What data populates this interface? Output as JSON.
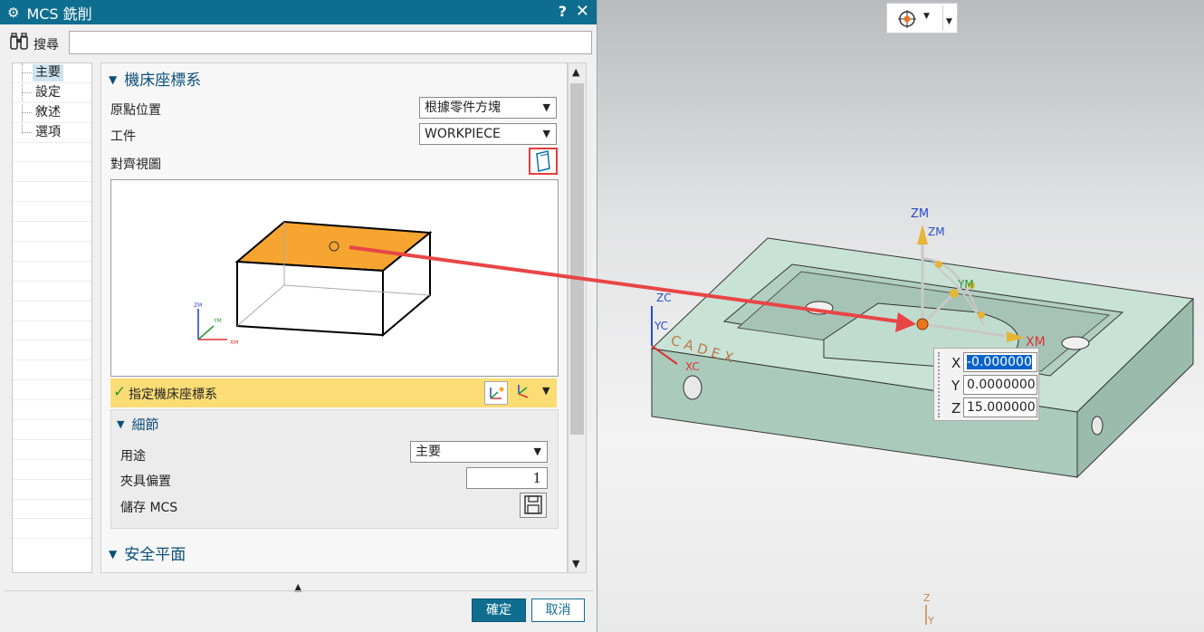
{
  "dialog": {
    "title": "MCS 銑削",
    "help": "?",
    "close": "✕",
    "search_label": "搜尋",
    "search_value": "",
    "nav": [
      "主要",
      "設定",
      "敘述",
      "選項"
    ],
    "section_main": "機床座標系",
    "origin_label": "原點位置",
    "origin_value": "根據零件方塊",
    "workpiece_label": "工件",
    "workpiece_value": "WORKPIECE",
    "align_view_label": "對齊視圖",
    "specify_mcs": "指定機床座標系",
    "details_title": "細節",
    "purpose_label": "用途",
    "purpose_value": "主要",
    "fixture_label": "夾具偏置",
    "fixture_value": "1",
    "save_mcs_label": "儲存 MCS",
    "safe_plane": "安全平面",
    "ok": "確定",
    "cancel": "取消",
    "preview_axes": {
      "zm": "ZM",
      "ym": "YM",
      "xm": "XM"
    }
  },
  "viewport": {
    "axes": {
      "zm": "ZM",
      "ym": "YM",
      "xm": "XM",
      "zc": "ZC",
      "yc": "YC",
      "xc": "XC",
      "z": "Z",
      "y": "Y"
    },
    "part_text": "C A D E X",
    "coords": [
      {
        "axis": "X",
        "value": "-0.000000"
      },
      {
        "axis": "Y",
        "value": "0.0000000"
      },
      {
        "axis": "Z",
        "value": "15.000000"
      }
    ]
  },
  "colors": {
    "accent": "#0f6e8f",
    "highlight": "#fbdc75",
    "arrow": "#e84545",
    "part": "#bcd9cc",
    "box_top": "#f7a531"
  }
}
